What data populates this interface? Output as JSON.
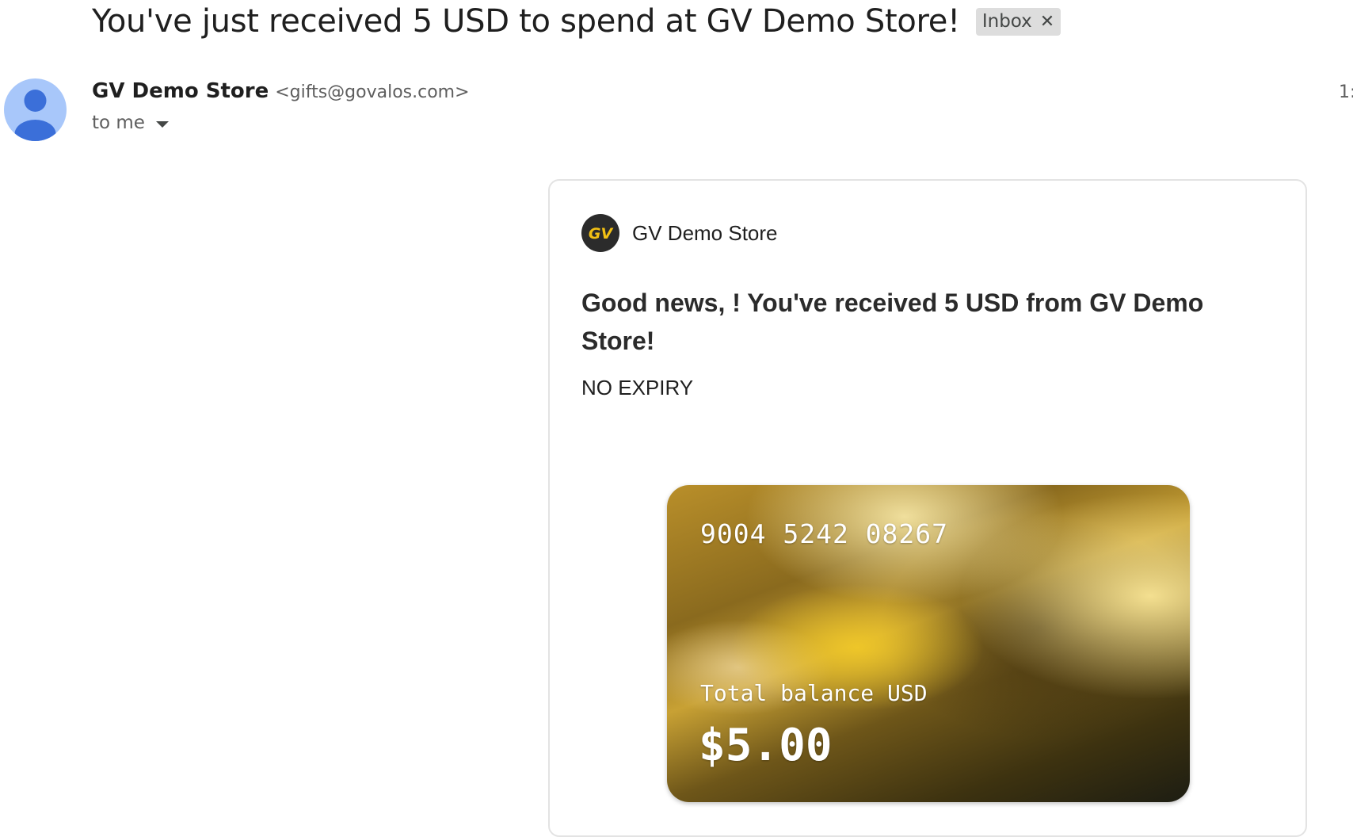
{
  "email": {
    "subject": "You've just received 5 USD to spend at GV Demo Store!",
    "label_chip": "Inbox",
    "sender_name": "GV Demo Store",
    "sender_email": "<gifts@govalos.com>",
    "recipient": "to me",
    "time_partial": "1:"
  },
  "body": {
    "store_name": "GV Demo Store",
    "logo_text": "GV",
    "headline": "Good news, ! You've received 5 USD from GV Demo Store!",
    "expiry": "NO EXPIRY"
  },
  "gift_card": {
    "number": "9004 5242 08267",
    "balance_label": "Total balance USD",
    "balance": "$5.00"
  },
  "colors": {
    "avatar_bg": "#a8c7fa",
    "avatar_fg": "#3b6fd9",
    "logo_bg": "#2b2b2b",
    "logo_accent": "#f2c014",
    "chip_bg": "#dddddd"
  },
  "icons": {
    "avatar": "person-icon",
    "chip_remove": "close-icon",
    "recipient_toggle": "caret-down-icon"
  }
}
